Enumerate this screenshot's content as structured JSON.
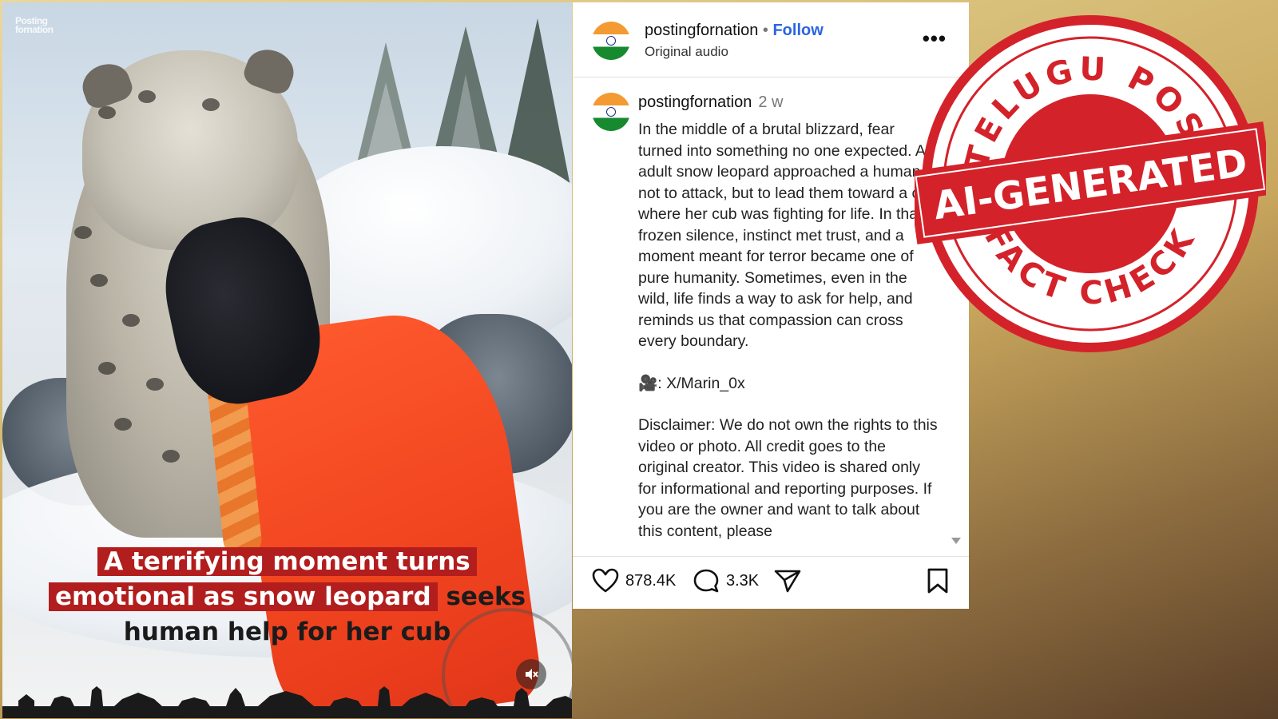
{
  "video": {
    "watermark_line1": "Posting",
    "watermark_line2": "fornation",
    "caption_line1": "A terrifying moment turns",
    "caption_line2_highlight": "emotional as snow leopard",
    "caption_line2_rest": " seeks",
    "caption_line3": "human help for her cub",
    "mute_icon": "speaker-muted-icon"
  },
  "post": {
    "header": {
      "username": "postingfornation",
      "separator": "•",
      "follow_label": "Follow",
      "audio_label": "Original audio",
      "more_icon": "•••"
    },
    "caption": {
      "username": "postingfornation",
      "time": "2 w",
      "paragraph1": "In the middle of a brutal blizzard, fear turned into something no one expected. An adult snow leopard approached a human, not to attack, but to lead them toward a cliff where her cub was fighting for life. In that frozen silence, instinct met trust, and a moment meant for terror became one of pure humanity. Sometimes, even in the wild, life finds a way to ask for help, and reminds us that compassion can cross every boundary.",
      "credit": "🎥: X/Marin_0x",
      "disclaimer": "Disclaimer: We do not own the rights to this video or photo. All credit goes to the original creator. This video is shared only for informational and reporting purposes. If you are the owner and want to talk about this content, please"
    },
    "actions": {
      "likes": "878.4K",
      "comments": "3.3K"
    }
  },
  "stamp": {
    "top_text": "TELUGU POST",
    "band_text": "AI-GENERATED",
    "bottom_text": "FACT CHECK",
    "color": "#d4222a"
  }
}
